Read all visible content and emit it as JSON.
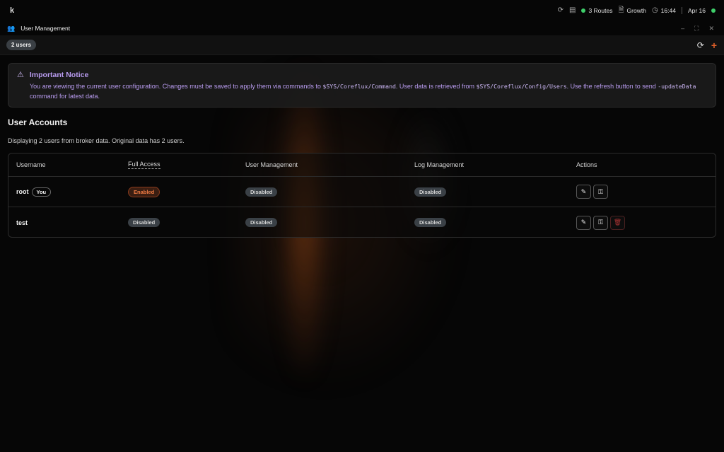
{
  "topbar": {
    "logo": "k",
    "routes": "3 Routes",
    "plan": "Growth",
    "time": "16:44",
    "date": "Apr 16",
    "icons": [
      "sync-icon",
      "layout-icon",
      "status-dot",
      "document-icon",
      "clock-icon",
      "status-dot"
    ]
  },
  "window": {
    "title": "User Management",
    "icon": "users-icon"
  },
  "toolbar": {
    "count_label": "2 users"
  },
  "notice": {
    "title": "Important Notice",
    "text_1": "You are viewing the current user configuration. Changes must be saved to apply them via commands to ",
    "code_1": "$SYS/Coreflux/Command",
    "text_2": ". User data is retrieved from ",
    "code_2": "$SYS/Coreflux/Config/Users",
    "text_3": ". Use the refresh button to send ",
    "code_3": "-updateData",
    "text_4": " command for latest data."
  },
  "section": {
    "title": "User Accounts",
    "description": "Displaying 2 users from broker data. Original data has 2 users."
  },
  "table": {
    "headers": [
      "Username",
      "Full Access",
      "User Management",
      "Log Management",
      "Actions"
    ],
    "rows": [
      {
        "username": "root",
        "you": "You",
        "full_access": "Enabled",
        "user_management": "Disabled",
        "log_management": "Disabled"
      },
      {
        "username": "test",
        "full_access": "Disabled",
        "user_management": "Disabled",
        "log_management": "Disabled"
      }
    ]
  },
  "colors": {
    "accent": "#e0602a",
    "notice_text": "#b99cf0",
    "status_green": "#3ecf6a",
    "badge_disabled": "#3a4046"
  }
}
